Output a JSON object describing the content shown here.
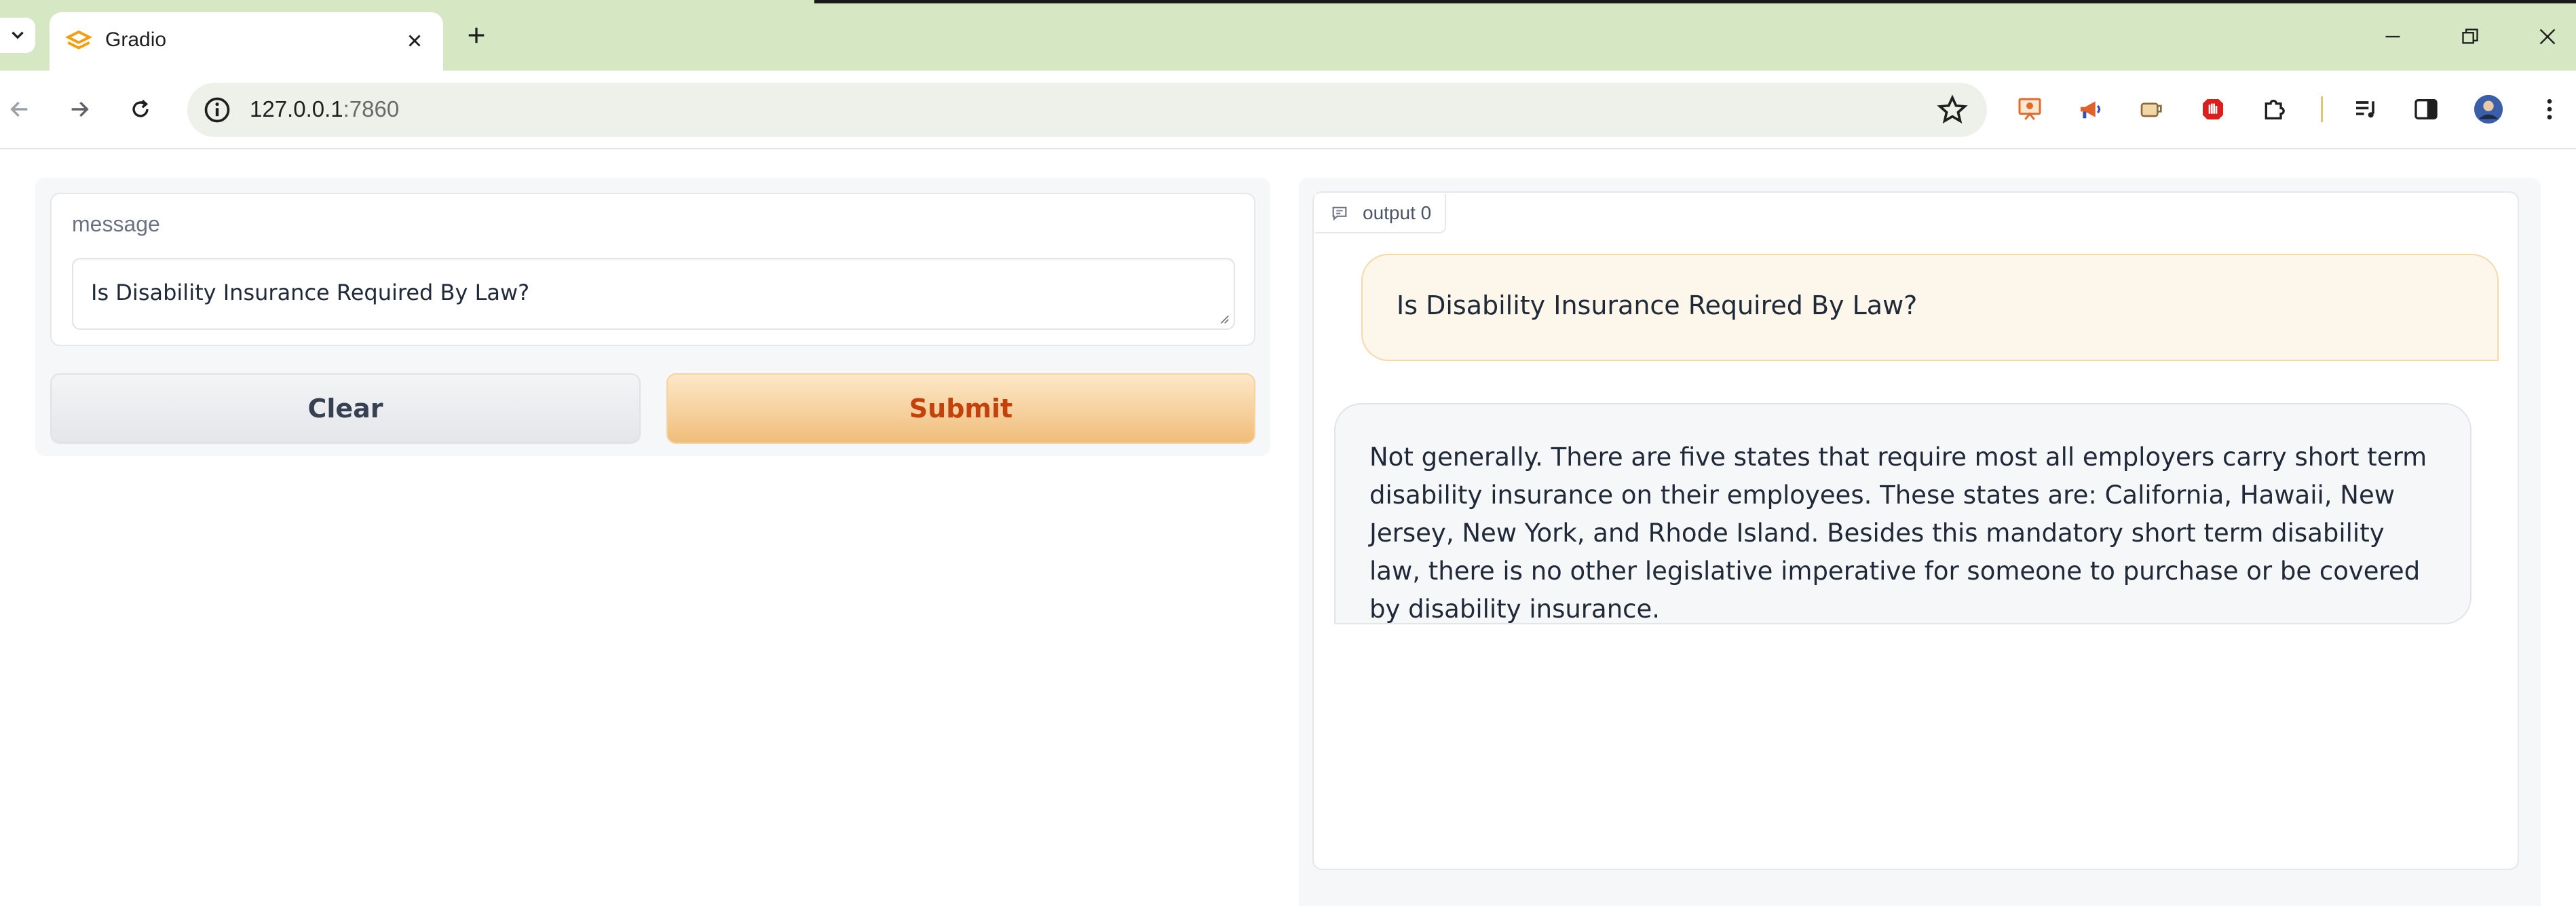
{
  "browser": {
    "tab_title": "Gradio",
    "url_host": "127.0.0.1",
    "url_port": ":7860"
  },
  "form": {
    "message_label": "message",
    "message_value": "Is Disability Insurance Required By Law?",
    "clear_label": "Clear",
    "submit_label": "Submit"
  },
  "output": {
    "label": "output 0",
    "messages": [
      {
        "role": "user",
        "text": "Is Disability Insurance Required By Law?"
      },
      {
        "role": "bot",
        "text": "Not generally. There are five states that require most all employers carry short term disability insurance on their employees. These states are: California, Hawaii, New Jersey, New York, and Rhode Island. Besides this mandatory short term disability law, there is no other legislative imperative for someone to purchase or be covered by disability insurance."
      }
    ]
  },
  "colors": {
    "tabbar": "#d6e8c3",
    "submit_text": "#c2410c",
    "user_bubble": "#fdf6ea"
  }
}
